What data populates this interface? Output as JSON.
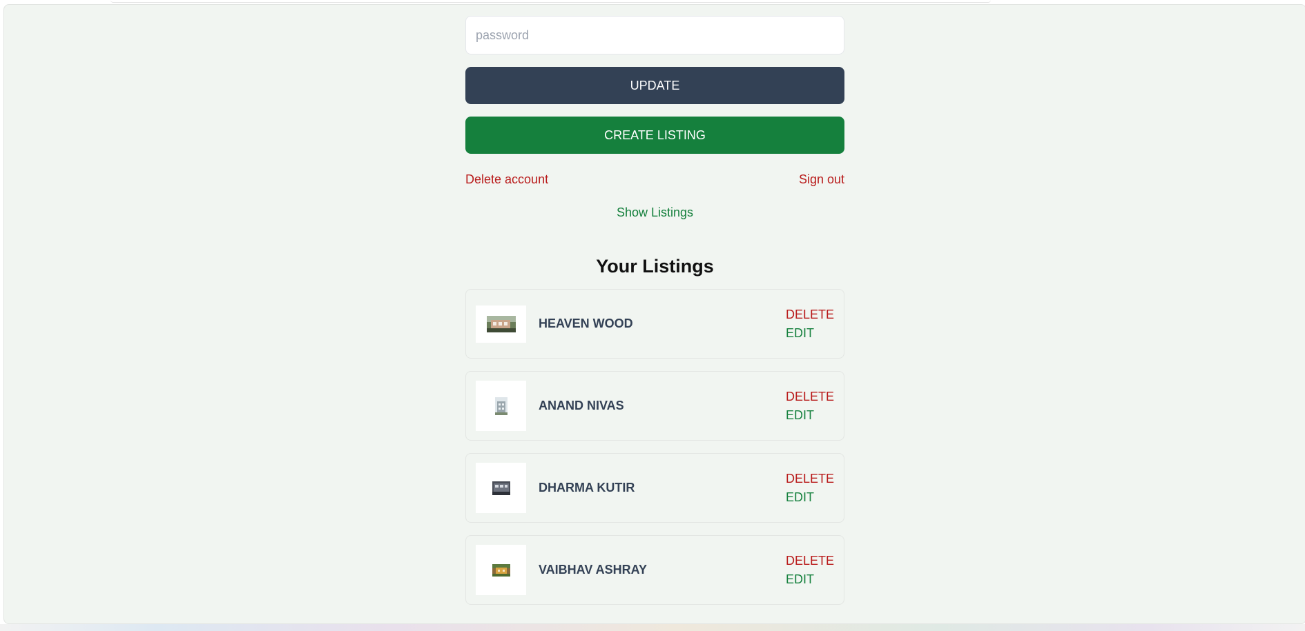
{
  "form": {
    "password_placeholder": "password",
    "update_label": "UPDATE",
    "create_listing_label": "CREATE LISTING"
  },
  "account_links": {
    "delete_account": "Delete account",
    "sign_out": "Sign out"
  },
  "show_listings": "Show Listings",
  "listings": {
    "title": "Your Listings",
    "delete_label": "DELETE",
    "edit_label": "EDIT",
    "items": [
      {
        "name": "HEAVEN WOOD"
      },
      {
        "name": "ANAND NIVAS"
      },
      {
        "name": "DHARMA KUTIR"
      },
      {
        "name": "VAIBHAV ASHRAY"
      }
    ]
  },
  "colors": {
    "page_bg": "#f1f5f1",
    "update_button": "#334155",
    "create_button": "#15803d",
    "danger_text": "#b91c1c",
    "success_text": "#15803d"
  }
}
